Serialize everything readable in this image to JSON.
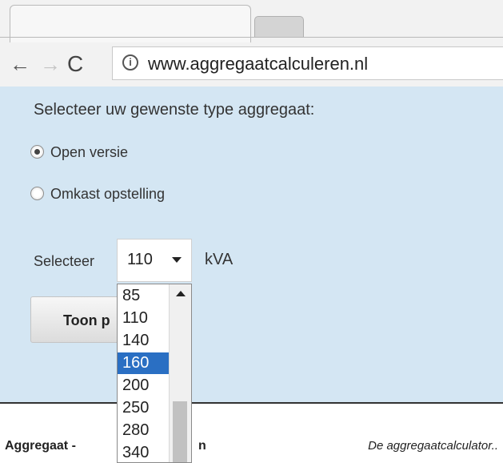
{
  "browser": {
    "url": "www.aggregaatcalculeren.nl",
    "back_icon": "←",
    "forward_icon": "→",
    "reload_icon": "C",
    "info_icon": "i"
  },
  "form": {
    "prompt": "Selecteer uw gewenste type aggregaat:",
    "options": [
      {
        "label": "Open versie",
        "checked": true
      },
      {
        "label": "Omkast opstelling",
        "checked": false
      }
    ],
    "select_label": "Selecteer",
    "selected_value": "110",
    "unit": "kVA",
    "button_label": "Toon p",
    "dropdown_options": [
      "85",
      "110",
      "140",
      "160",
      "200",
      "250",
      "280",
      "340"
    ],
    "highlighted_option": "160"
  },
  "footer": {
    "title_left": "Aggregaat -",
    "title_right": "n",
    "caption": "De aggregaatcalculator.."
  },
  "colors": {
    "content_bg": "#d4e6f3",
    "highlight": "#2a6fc3"
  }
}
